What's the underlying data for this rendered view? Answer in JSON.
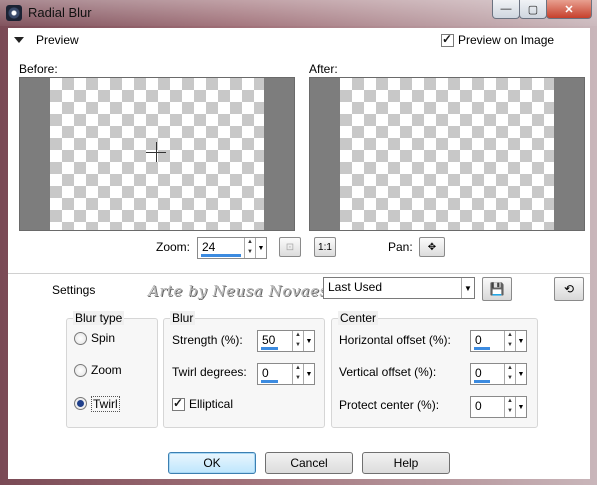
{
  "window": {
    "title": "Radial Blur",
    "minimize_glyph": "—",
    "maximize_glyph": "▢",
    "close_glyph": "✕"
  },
  "preview": {
    "section_label": "Preview",
    "preview_on_image_label": "Preview on Image",
    "preview_on_image_checked": true,
    "before_label": "Before:",
    "after_label": "After:",
    "zoom_label": "Zoom:",
    "zoom_value": "24",
    "pan_label": "Pan:",
    "zoom_fit_glyph": "⊡",
    "zoom_actual_glyph": "1:1",
    "pan_glyph": "✥"
  },
  "settings": {
    "label": "Settings",
    "preset_value": "Last Used",
    "watermark": "Arte by Neusa Novaes",
    "save_glyph": "💾",
    "reset_glyph": "⟲"
  },
  "blur_type": {
    "title": "Blur type",
    "options": [
      {
        "label": "Spin",
        "selected": false
      },
      {
        "label": "Zoom",
        "selected": false
      },
      {
        "label": "Twirl",
        "selected": true
      }
    ]
  },
  "blur": {
    "title": "Blur",
    "strength_label": "Strength (%):",
    "strength_value": "50",
    "twirl_label": "Twirl degrees:",
    "twirl_value": "0",
    "elliptical_label": "Elliptical",
    "elliptical_checked": true
  },
  "center": {
    "title": "Center",
    "horizontal_label": "Horizontal offset (%):",
    "horizontal_value": "0",
    "vertical_label": "Vertical offset (%):",
    "vertical_value": "0",
    "protect_label": "Protect center (%):",
    "protect_value": "0"
  },
  "buttons": {
    "ok": "OK",
    "cancel": "Cancel",
    "help": "Help"
  }
}
